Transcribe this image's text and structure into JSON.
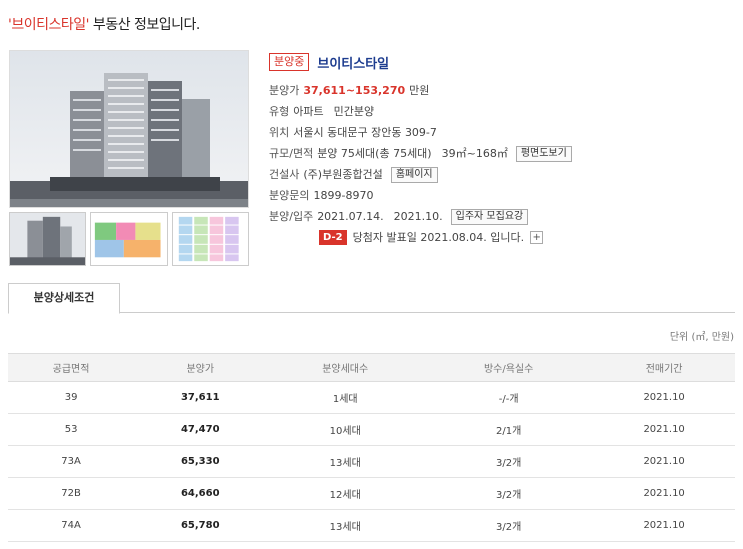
{
  "heading": {
    "highlight": "'브이티스타일'",
    "rest": " 부동산 정보입니다."
  },
  "summary": {
    "status": "분양중",
    "name": "브이티스타일",
    "price_label": "분양가",
    "price": "37,611~153,270",
    "price_unit": "만원",
    "type_label": "유형",
    "type": "아파트",
    "type2": "민간분양",
    "location_label": "위치",
    "location": "서울시 동대문구 장안동 309-7",
    "scale_label": "규모/면적",
    "scale": "분양 75세대(총 75세대)",
    "area": "39㎡~168㎡",
    "floorplan_button": "평면도보기",
    "builder_label": "건설사",
    "builder": "(주)부원종합건설",
    "homepage_button": "홈페이지",
    "inquiry_label": "분양문의",
    "inquiry": "1899-8970",
    "schedule_label": "분양/입주",
    "sale_date": "2021.07.14.",
    "move_date": "2021.10.",
    "notice_button": "입주자 모집요강",
    "dday": "D-2",
    "announce": "당첨자 발표일 2021.08.04. 입니다.",
    "plus": "+"
  },
  "tab": {
    "label": "분양상세조건"
  },
  "unit_note": "단위 (㎡, 만원)",
  "table": {
    "headers": [
      "공급면적",
      "분양가",
      "분양세대수",
      "방수/욕실수",
      "전매기간"
    ],
    "rows": [
      [
        "39",
        "37,611",
        "1세대",
        "-/-개",
        "2021.10"
      ],
      [
        "53",
        "47,470",
        "10세대",
        "2/1개",
        "2021.10"
      ],
      [
        "73A",
        "65,330",
        "13세대",
        "3/2개",
        "2021.10"
      ],
      [
        "72B",
        "64,660",
        "12세대",
        "3/2개",
        "2021.10"
      ],
      [
        "74A",
        "65,780",
        "13세대",
        "3/2개",
        "2021.10"
      ]
    ]
  },
  "colors": {
    "accent": "#d9342b",
    "name": "#1d3c8f"
  }
}
